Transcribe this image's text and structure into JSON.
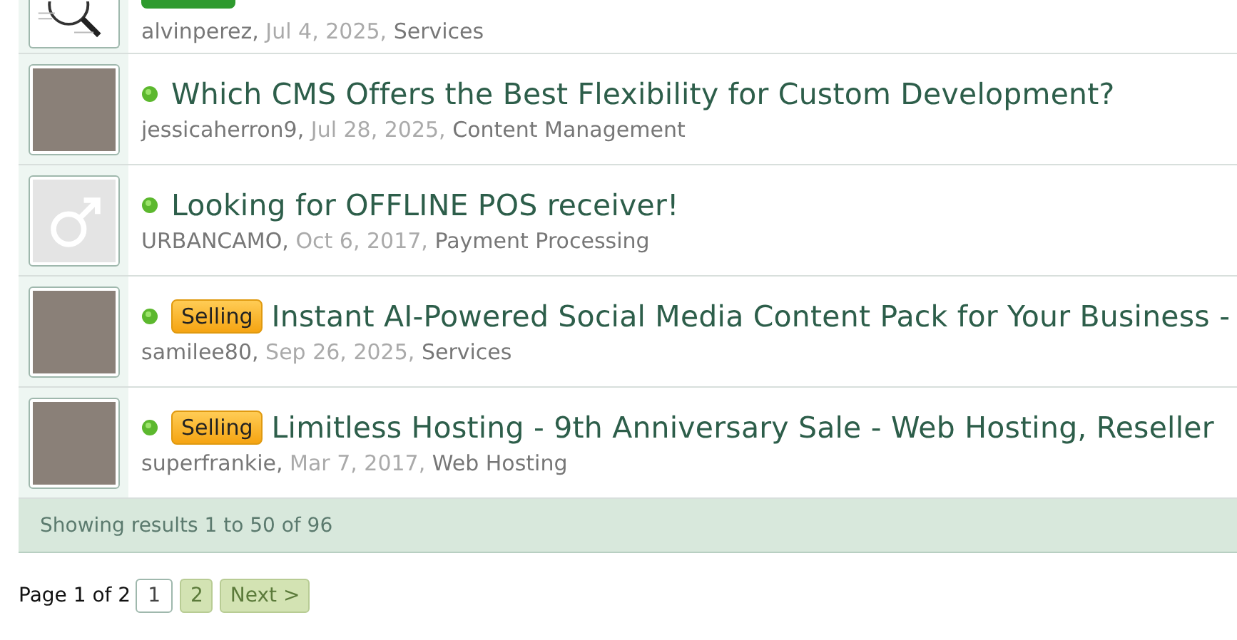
{
  "threads": [
    {
      "kind": "drawing",
      "author": "alvinperez,",
      "date": "Jul 4, 2025,",
      "forum": "Services"
    },
    {
      "kind": "photo",
      "title": "Which CMS Offers the Best Flexibility for Custom Development?",
      "author": "jessicaherron9,",
      "date": "Jul 28, 2025,",
      "forum": "Content Management"
    },
    {
      "kind": "default",
      "title": "Looking for OFFLINE POS receiver!",
      "author": "URBANCAMO,",
      "date": "Oct 6, 2017,",
      "forum": "Payment Processing"
    },
    {
      "kind": "photo",
      "prefix": "Selling",
      "title": "Instant AI-Powered Social Media Content Pack for Your Business -",
      "author": "samilee80,",
      "date": "Sep 26, 2025,",
      "forum": "Services"
    },
    {
      "kind": "photo",
      "prefix": "Selling",
      "title": "Limitless Hosting - 9th Anniversary Sale - Web Hosting, Reseller",
      "author": "superfrankie,",
      "date": "Mar 7, 2017,",
      "forum": "Web Hosting"
    }
  ],
  "footer": "Showing results 1 to 50 of 96",
  "pager": {
    "label": "Page 1 of 2",
    "pages": [
      {
        "label": "1",
        "selected": true
      },
      {
        "label": "2",
        "selected": false
      }
    ],
    "next": "Next >"
  }
}
